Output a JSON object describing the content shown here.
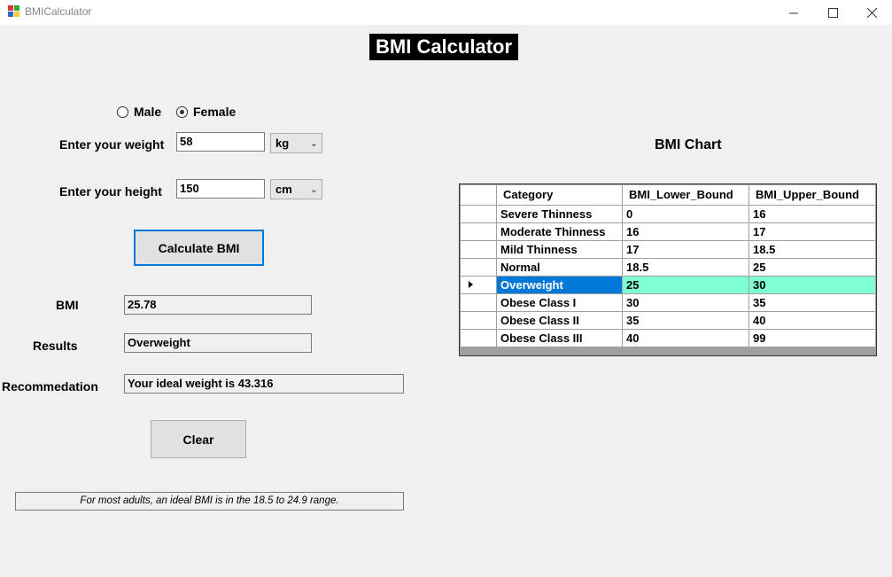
{
  "window": {
    "title": "BMICalculator"
  },
  "form": {
    "title": "BMI Calculator",
    "gender": {
      "male_label": "Male",
      "female_label": "Female",
      "selected": "Female"
    },
    "weight": {
      "label": "Enter your weight",
      "value": "58",
      "unit": "kg"
    },
    "height": {
      "label": "Enter your height",
      "value": "150",
      "unit": "cm"
    },
    "calculate_label": "Calculate BMI",
    "bmi": {
      "label": "BMI",
      "value": "25.78"
    },
    "results": {
      "label": "Results",
      "value": "Overweight"
    },
    "recommendation": {
      "label": "Recommedation",
      "value": "Your ideal weight is 43.316"
    },
    "clear_label": "Clear",
    "note": "For most adults, an ideal BMI is in the 18.5 to 24.9 range."
  },
  "chart": {
    "title": "BMI Chart",
    "columns": [
      "Category",
      "BMI_Lower_Bound",
      "BMI_Upper_Bound"
    ],
    "rows": [
      [
        "Severe Thinness",
        "0",
        "16"
      ],
      [
        "Moderate Thinness",
        "16",
        "17"
      ],
      [
        "Mild Thinness",
        "17",
        "18.5"
      ],
      [
        "Normal",
        "18.5",
        "25"
      ],
      [
        "Overweight",
        "25",
        "30"
      ],
      [
        "Obese Class I",
        "30",
        "35"
      ],
      [
        "Obese Class II",
        "35",
        "40"
      ],
      [
        "Obese Class III",
        "40",
        "99"
      ]
    ],
    "selected_row": 4,
    "colors": {
      "selection": "#0078d7",
      "highlight": "#7fffd4"
    }
  }
}
